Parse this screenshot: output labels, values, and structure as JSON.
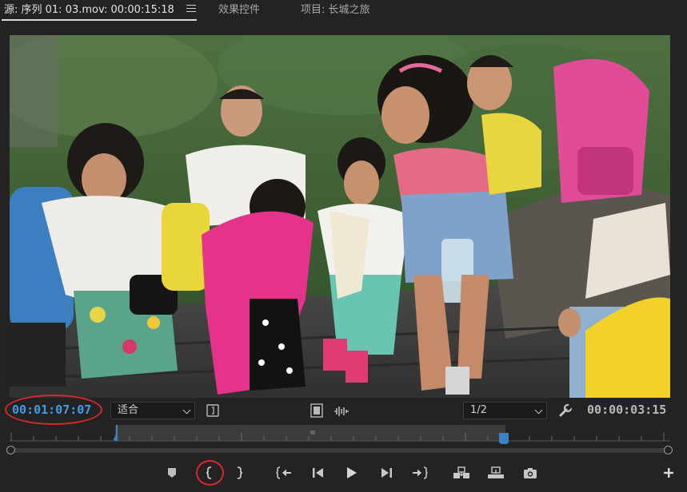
{
  "tabs": [
    {
      "label": "源: 序列 01: 03.mov: 00:00:15:18",
      "active": true
    },
    {
      "label": "效果控件",
      "active": false
    },
    {
      "label": "项目: 长城之旅",
      "active": false
    }
  ],
  "controls": {
    "playhead_timecode": "00:01:07:07",
    "zoom_select": "适合",
    "resolution_select": "1/2",
    "duration_timecode": "00:00:03:15"
  },
  "icons": {
    "panel_menu": "hamburger-menu-icon",
    "export_frame_settings": "bracket-settings-icon",
    "drag_video_only": "film-strip-icon",
    "drag_audio_only": "audio-waveform-icon",
    "settings": "wrench-icon",
    "add_marker": "marker-icon",
    "mark_in": "mark-in-icon",
    "mark_out": "mark-out-icon",
    "go_to_in": "go-to-in-icon",
    "step_back": "step-back-icon",
    "play": "play-icon",
    "step_forward": "step-forward-icon",
    "go_to_out": "go-to-out-icon",
    "insert": "insert-icon",
    "overwrite": "overwrite-icon",
    "export_frame": "camera-icon",
    "button_editor": "plus-icon"
  },
  "colors": {
    "timecode_blue": "#3d9ee6",
    "annotation_red": "#d8282e",
    "panel_bg": "#232323",
    "in_out_marker": "#3b82c4"
  }
}
